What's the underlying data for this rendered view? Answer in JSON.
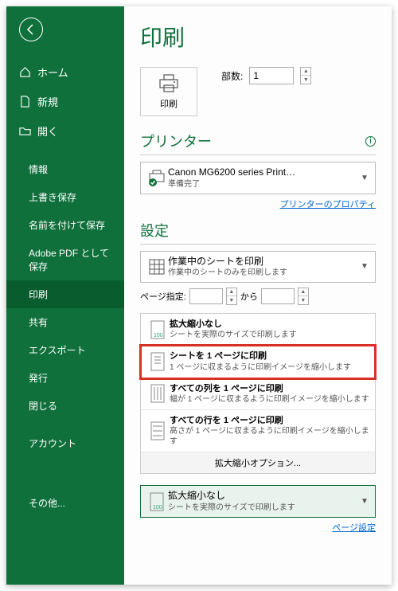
{
  "sidebar": {
    "items": [
      {
        "label": "ホーム",
        "icon": "home"
      },
      {
        "label": "新規",
        "icon": "file"
      },
      {
        "label": "開く",
        "icon": "folder"
      }
    ],
    "subitems": [
      "情報",
      "上書き保存",
      "名前を付けて保存",
      "Adobe PDF として保存",
      "印刷",
      "共有",
      "エクスポート",
      "発行",
      "閉じる"
    ],
    "account": "アカウント",
    "other": "その他..."
  },
  "main": {
    "title": "印刷",
    "copies_label": "部数:",
    "copies_value": "1",
    "print_btn": "印刷",
    "printer_section": "プリンター",
    "printer_name": "Canon MG6200 series Print…",
    "printer_status": "準備完了",
    "printer_props": "プリンターのプロパティ",
    "settings_section": "設定",
    "scope_title": "作業中のシートを印刷",
    "scope_desc": "作業中のシートのみを印刷します",
    "page_label": "ページ指定:",
    "page_to": "から",
    "options": [
      {
        "t": "拡大縮小なし",
        "d": "シートを実際のサイズで印刷します"
      },
      {
        "t": "シートを 1 ページに印刷",
        "d": "1 ページに収まるように印刷イメージを縮小します"
      },
      {
        "t": "すべての列を 1 ページに印刷",
        "d": "幅が 1 ページに収まるように印刷イメージを縮小します"
      },
      {
        "t": "すべての行を 1 ページに印刷",
        "d": "高さが 1 ページに収まるように印刷イメージを縮小します"
      }
    ],
    "options_footer": "拡大縮小オプション...",
    "scale_title": "拡大縮小なし",
    "scale_desc": "シートを実際のサイズで印刷します",
    "page_setup": "ページ設定"
  }
}
